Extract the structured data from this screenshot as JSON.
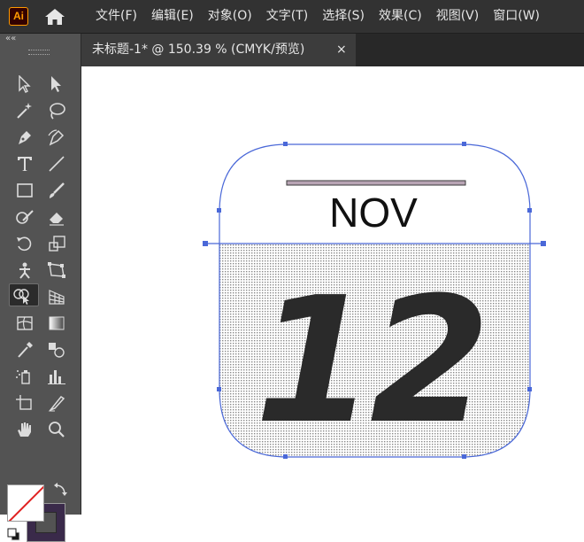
{
  "app": {
    "logo_text": "Ai",
    "home_icon": "home-icon"
  },
  "menu": [
    "文件(F)",
    "编辑(E)",
    "对象(O)",
    "文字(T)",
    "选择(S)",
    "效果(C)",
    "视图(V)",
    "窗口(W)"
  ],
  "document_tab": {
    "title": "未标题-1* @ 150.39 % (CMYK/预览)",
    "close_glyph": "×"
  },
  "toolbar": {
    "collapse_glyph": "««",
    "tools": [
      "selection-tool-icon",
      "direct-selection-tool-icon",
      "magic-wand-tool-icon",
      "lasso-tool-icon",
      "pen-tool-icon",
      "curvature-tool-icon",
      "type-tool-icon",
      "line-segment-tool-icon",
      "rectangle-tool-icon",
      "paintbrush-tool-icon",
      "shaper-tool-icon",
      "eraser-tool-icon",
      "rotate-tool-icon",
      "scale-tool-icon",
      "puppet-warp-tool-icon",
      "free-transform-tool-icon",
      "shape-builder-tool-icon",
      "perspective-grid-tool-icon",
      "mesh-tool-icon",
      "gradient-tool-icon",
      "eyedropper-tool-icon",
      "blend-tool-icon",
      "symbol-sprayer-tool-icon",
      "column-graph-tool-icon",
      "artboard-tool-icon",
      "slice-tool-icon",
      "hand-tool-icon",
      "zoom-tool-icon"
    ],
    "active_tool": "shape-builder-tool-icon",
    "fill_color": "#ffffff",
    "stroke_color": "#3a2a4a"
  },
  "artwork": {
    "month": "NOV",
    "day": "12",
    "selection_color": "#4a68d8",
    "bar_color": "#b8a4b4"
  }
}
